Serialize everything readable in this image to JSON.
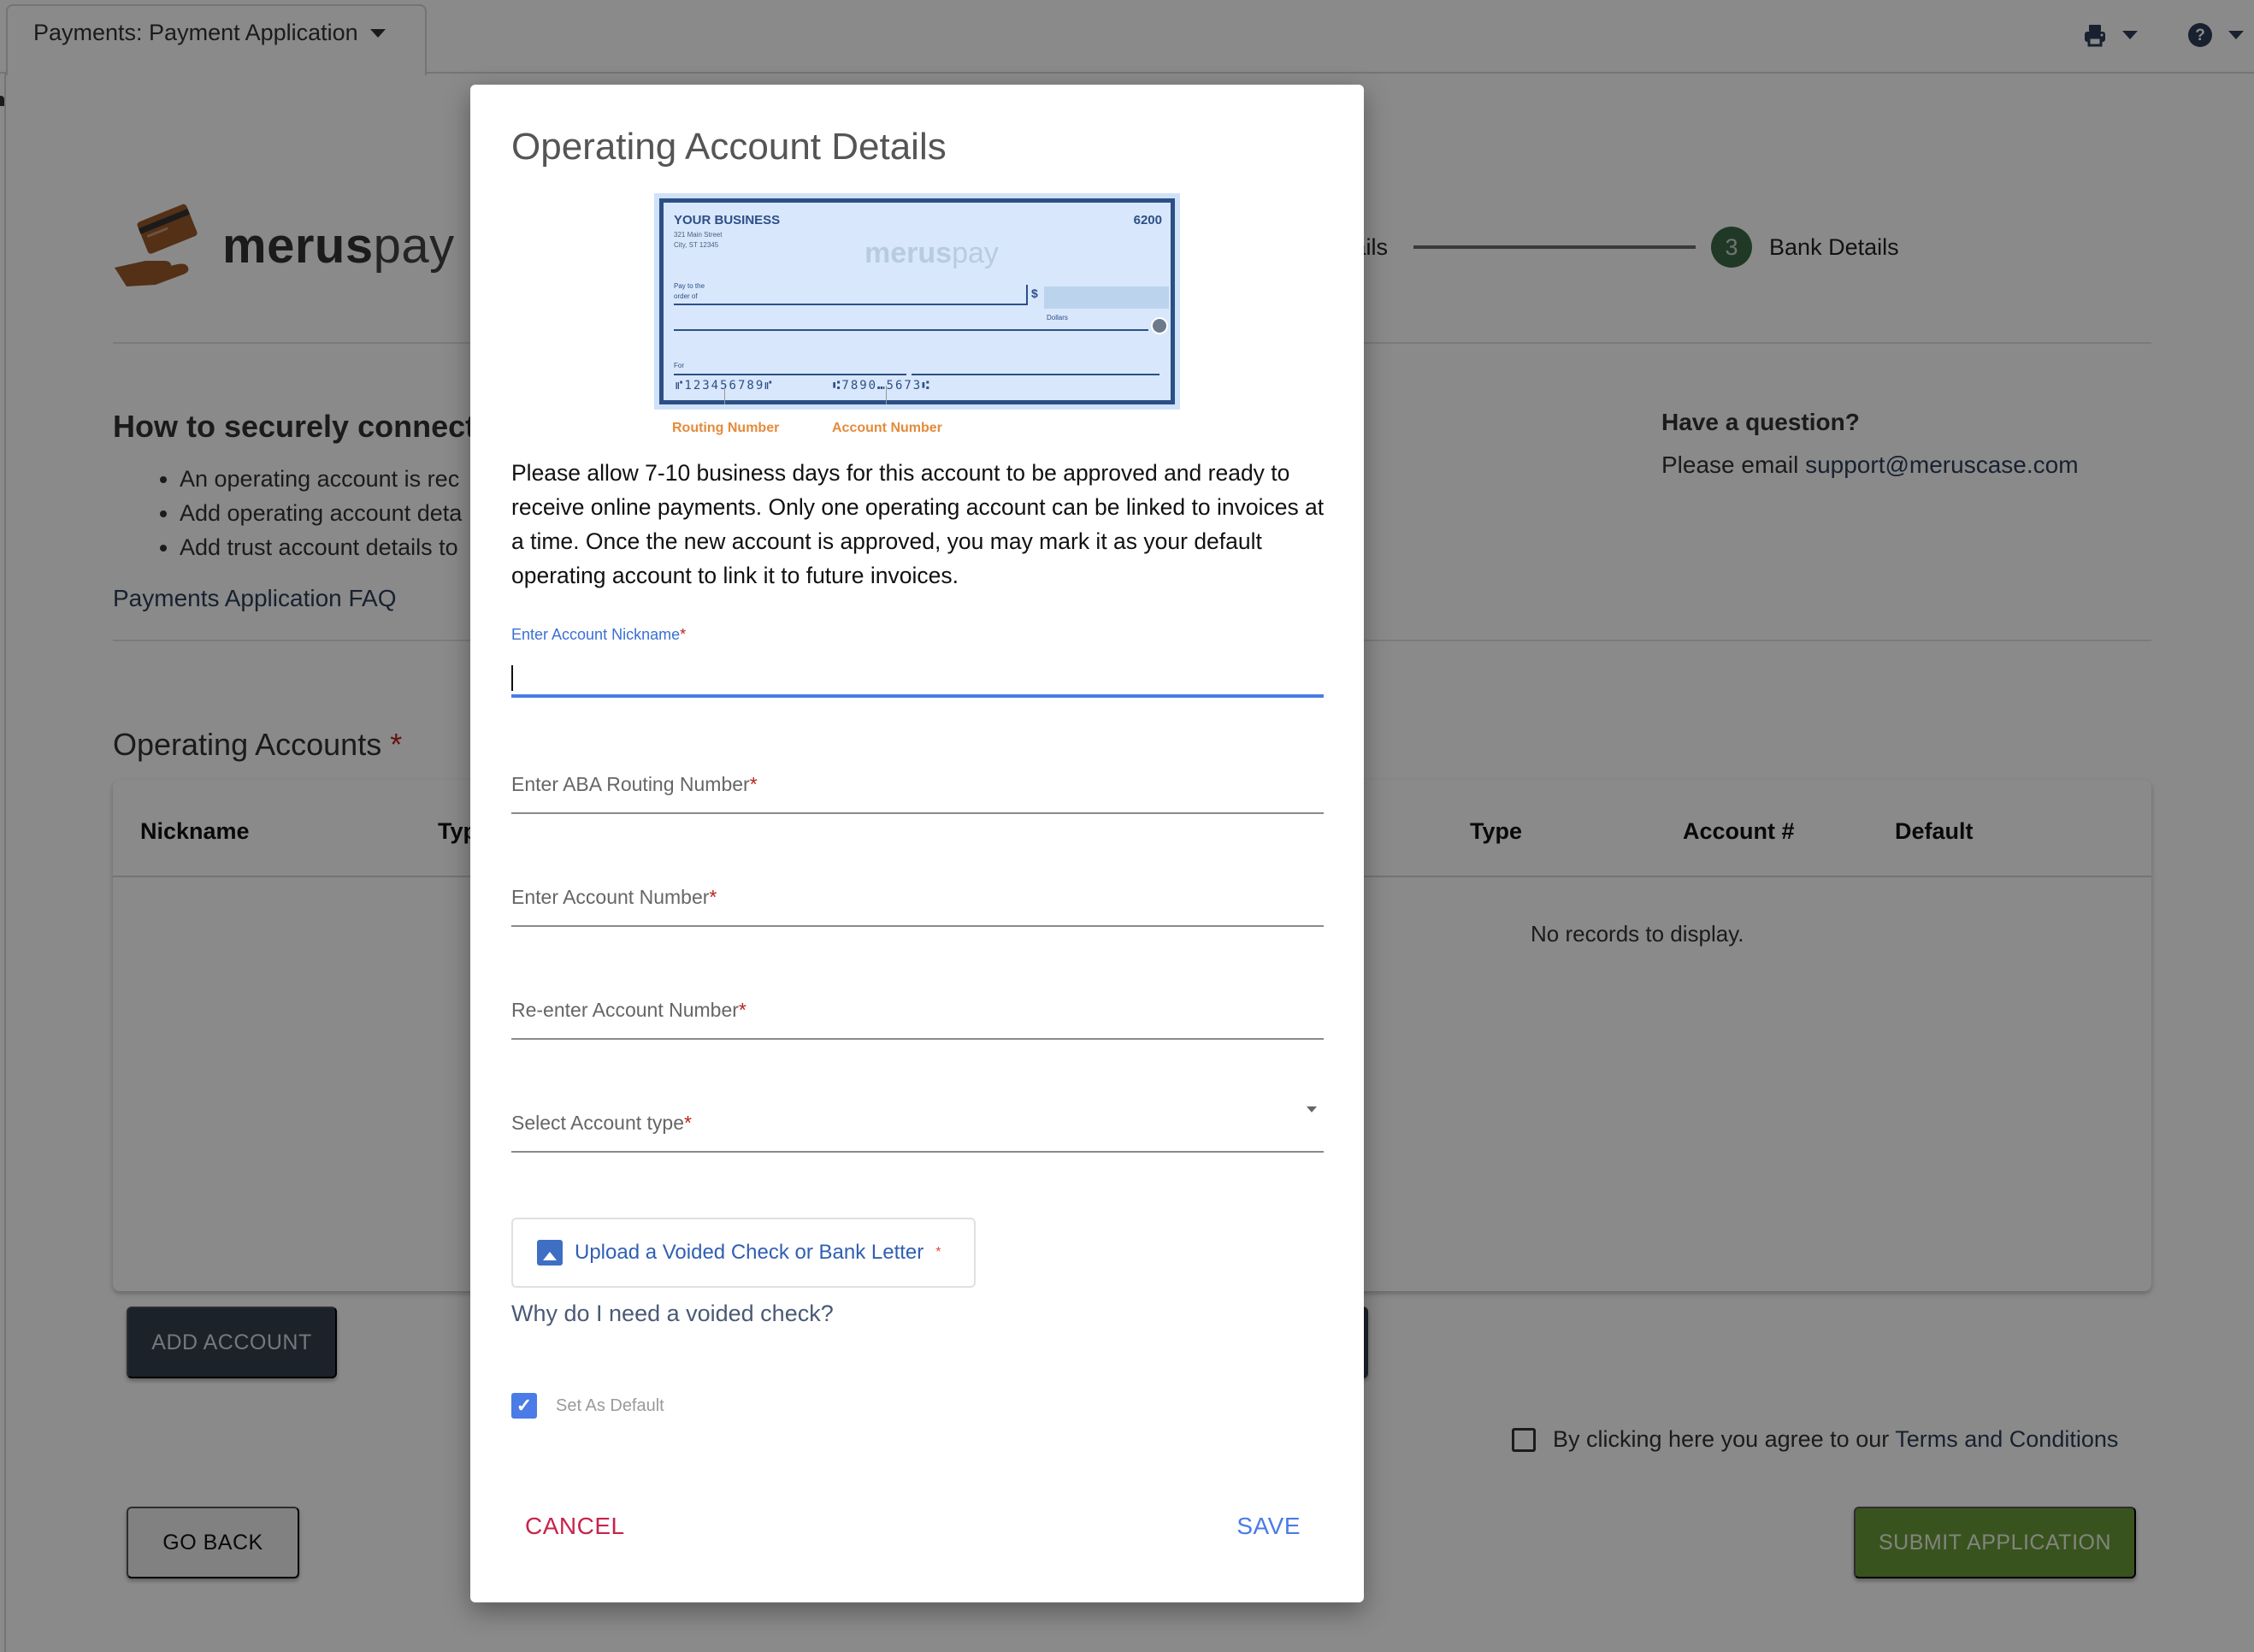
{
  "header": {
    "tab_label": "Payments: Payment Application",
    "tools": [
      {
        "icon": "printer-icon"
      },
      {
        "icon": "help-circle-icon"
      }
    ]
  },
  "logo": {
    "bold": "merus",
    "light": "pay"
  },
  "stepper": {
    "prev_label_partial": "etails",
    "current_step_number": "3",
    "current_step_label": "Bank Details"
  },
  "howto": {
    "title_partial": "How to securely connect",
    "bullets": [
      "An operating account is rec",
      "Add operating account deta",
      "Add trust account details to"
    ],
    "faq_link": "Payments Application FAQ"
  },
  "question": {
    "title": "Have a question?",
    "prefix": "Please email ",
    "email": "support@meruscase.com"
  },
  "operating_accounts": {
    "title": "Operating Accounts",
    "required_mark": "*",
    "columns_left": [
      "Nickname",
      "Typ"
    ],
    "columns_right": [
      "Type",
      "Account #",
      "Default"
    ],
    "empty_text": "No records to display.",
    "add_button": "ADD ACCOUNT"
  },
  "footer": {
    "terms_prefix": "By clicking here you agree to our ",
    "terms_link": "Terms and Conditions",
    "terms_checked": false,
    "go_back": "GO BACK",
    "submit": "SUBMIT APPLICATION"
  },
  "modal": {
    "title": "Operating Account Details",
    "check_image": {
      "business": "YOUR BUSINESS",
      "address_line1": "321 Main Street",
      "address_line2": "City, ST 12345",
      "check_number": "6200",
      "watermark_bold": "merus",
      "watermark_light": "pay",
      "pay_to_line1": "Pay to the",
      "pay_to_line2": "order of",
      "dollar_sign": "$",
      "dollars_label": "Dollars",
      "for_label": "For",
      "micr_routing": "⑈123456789⑈",
      "micr_account": "⑆7890⑉5673⑆",
      "routing_caption": "Routing Number",
      "account_caption": "Account Number"
    },
    "description": "Please allow 7-10 business days for this account to be approved and ready to receive online payments. Only one operating account can be linked to invoices at a time. Once the new account is approved, you may mark it as your default operating account to link it to future invoices.",
    "fields": {
      "nickname": {
        "label": "Enter Account Nickname",
        "required": "*",
        "value": ""
      },
      "routing": {
        "label": "Enter ABA Routing Number",
        "required": "*",
        "value": ""
      },
      "account": {
        "label": "Enter Account Number",
        "required": "*",
        "value": ""
      },
      "account_confirm": {
        "label": "Re-enter Account Number",
        "required": "*",
        "value": ""
      },
      "account_type": {
        "label": "Select Account type",
        "required": "*",
        "value": ""
      }
    },
    "upload_button": "Upload a Voided Check or Bank Letter",
    "upload_required": "*",
    "why_link": "Why do I need a voided check?",
    "set_default_label": "Set As Default",
    "set_default_checked": true,
    "cancel": "CANCEL",
    "save": "SAVE"
  },
  "colors": {
    "primary_blue": "#4a7be6",
    "cancel_red": "#c8234b",
    "brand_dark": "#33404f",
    "submit_green": "#6a9a38",
    "step_green": "#3b6a46",
    "caption_orange": "#e58a3b"
  }
}
